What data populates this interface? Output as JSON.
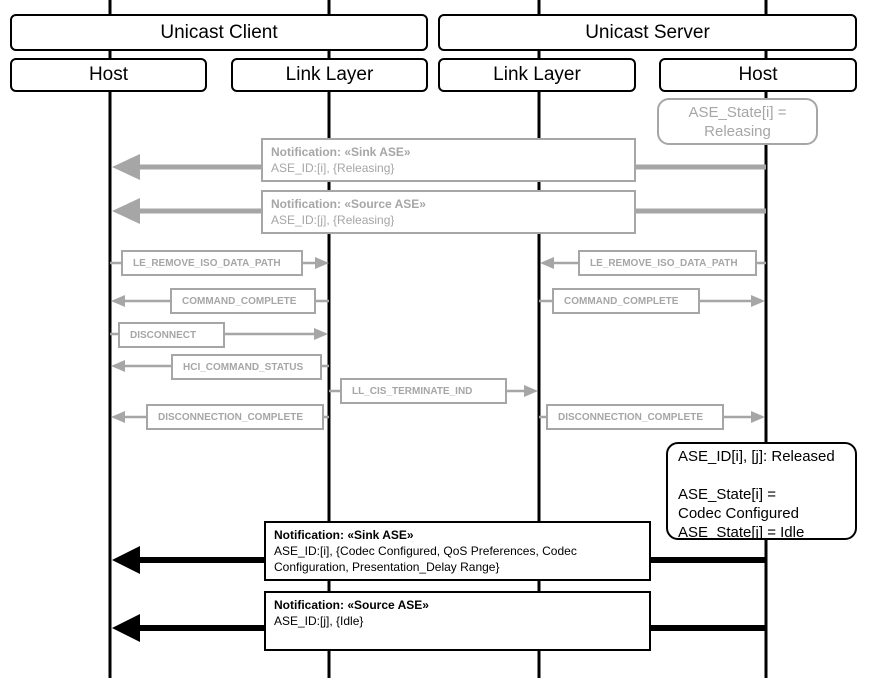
{
  "headers": {
    "client": "Unicast Client",
    "server": "Unicast Server",
    "client_host": "Host",
    "client_link": "Link Layer",
    "server_link": "Link Layer",
    "server_host": "Host"
  },
  "states": {
    "releasing": "ASE_State[i] = Releasing",
    "released_line1": "ASE_ID[i], [j]: Released",
    "released_line2": "ASE_State[i] =",
    "released_line3": "Codec Configured",
    "released_line4": "ASE_State[j] = Idle"
  },
  "notifications": [
    {
      "title": "Notification: «Sink ASE»",
      "body": "ASE_ID:[i], {Releasing}"
    },
    {
      "title": "Notification: «Source ASE»",
      "body": "ASE_ID:[j], {Releasing}"
    },
    {
      "title": "Notification: «Sink ASE»",
      "body": "ASE_ID:[i], {Codec Configured, QoS Preferences, Codec Configuration, Presentation_Delay Range}"
    },
    {
      "title": "Notification: «Source ASE»",
      "body": "ASE_ID:[j], {Idle}"
    }
  ],
  "messages": {
    "le_remove_client": "LE_REMOVE_ISO_DATA_PATH",
    "le_remove_server": "LE_REMOVE_ISO_DATA_PATH",
    "cmd_complete_client": "COMMAND_COMPLETE",
    "cmd_complete_server": "COMMAND_COMPLETE",
    "disconnect": "DISCONNECT",
    "hci_command_status": "HCI_COMMAND_STATUS",
    "ll_cis_terminate": "LL_CIS_TERMINATE_IND",
    "disc_complete_client": "DISCONNECTION_COMPLETE",
    "disc_complete_server": "DISCONNECTION_COMPLETE"
  },
  "colors": {
    "active": "#000000",
    "inactive": "#a6a6a6"
  }
}
